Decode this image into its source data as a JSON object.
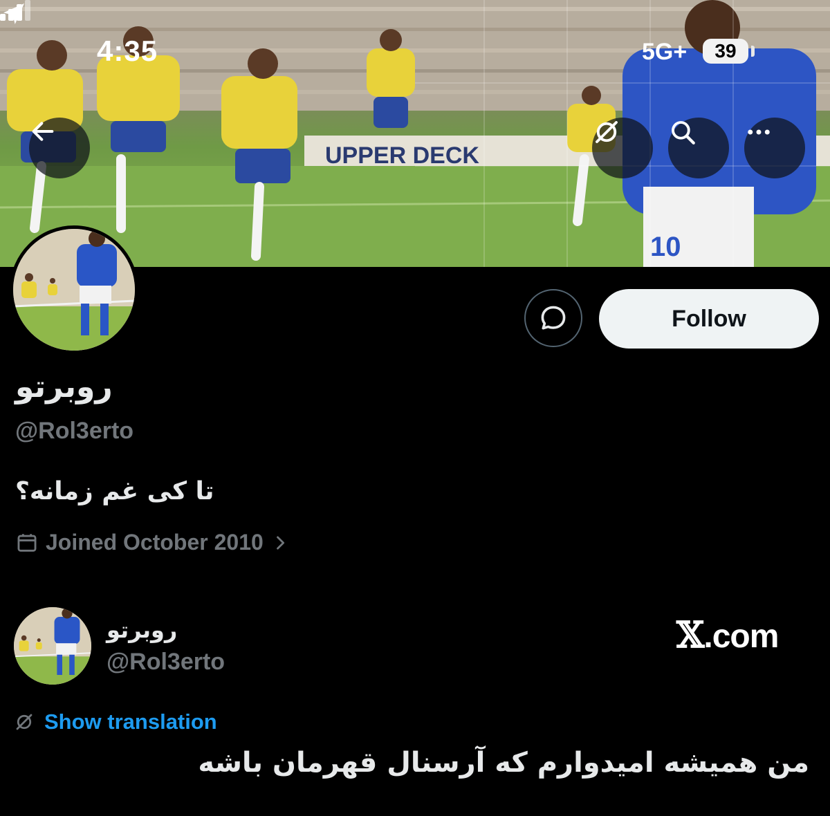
{
  "status_bar": {
    "time": "4:35",
    "network": "5G+",
    "battery": "39"
  },
  "header": {
    "back_icon": "arrow-left-icon",
    "translate_icon": "translate-slash-icon",
    "search_icon": "search-icon",
    "more_icon": "more-horizontal-icon"
  },
  "banner": {
    "board_text": "UPPER DECK"
  },
  "profile": {
    "display_name": "روبرتو",
    "handle": "@Rol3erto",
    "bio": "تا کی غم زمانه؟",
    "joined": "Joined October 2010",
    "follow_label": "Follow",
    "message_icon": "message-icon"
  },
  "tweet": {
    "author_name": "روبرتو",
    "author_handle": "@Rol3erto",
    "show_translation": "Show translation",
    "text": "من همیشه امیدوارم که آرسنال قهرمان باشه"
  },
  "watermark": {
    "x": "𝕏",
    "domain": ".com"
  },
  "colors": {
    "background": "#000000",
    "primary_text": "#e7e9ea",
    "secondary_text": "#71767b",
    "link": "#1d9bf0",
    "follow_bg": "#eff3f4"
  }
}
